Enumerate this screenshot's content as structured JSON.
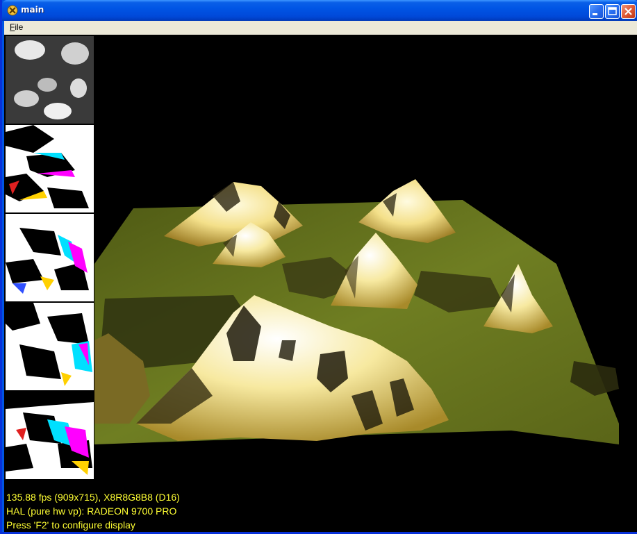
{
  "window": {
    "title": "main",
    "buttons": {
      "minimize": "minimize",
      "maximize": "maximize",
      "close": "close"
    }
  },
  "menu": {
    "items": [
      {
        "label_underlined": "F",
        "label_rest": "ile"
      }
    ]
  },
  "hud": {
    "line1": "135.88 fps (909x715), X8R8G8B8 (D16)",
    "line2": "HAL (pure hw vp): RADEON 9700 PRO",
    "line3": "Press 'F2' to configure display",
    "color": "#ffff33"
  },
  "colors": {
    "titlebar": "#0054e3",
    "menubar": "#ece9d8",
    "viewport": "#000000",
    "terrain_grass": "#6b7a1e",
    "terrain_snow": "#fff6c8"
  },
  "icons": {
    "app": "app-icon",
    "minimize": "minimize-icon",
    "maximize": "maximize-icon",
    "close": "close-icon"
  }
}
